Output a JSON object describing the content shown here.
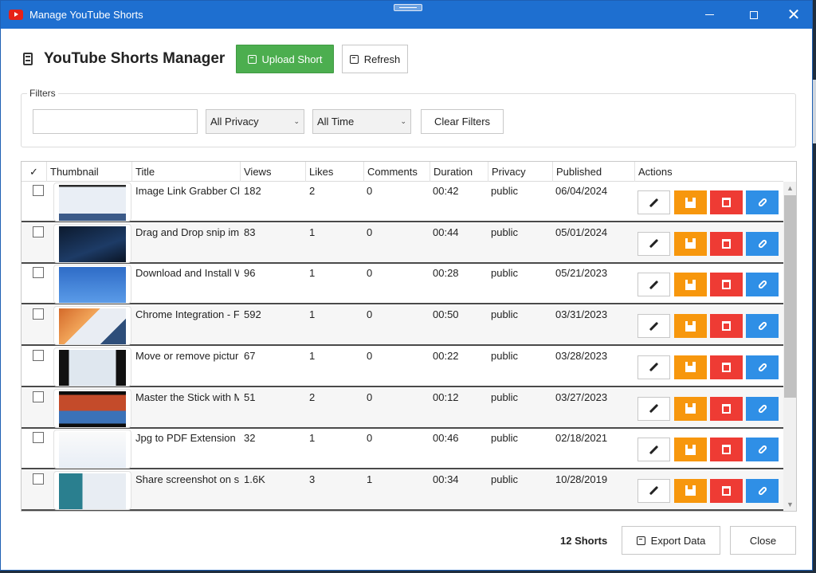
{
  "window": {
    "title": "Manage YouTube Shorts"
  },
  "header": {
    "title": "YouTube Shorts Manager",
    "upload_label": "Upload Short",
    "refresh_label": "Refresh"
  },
  "filters": {
    "legend": "Filters",
    "search_value": "",
    "privacy_selected": "All Privacy",
    "time_selected": "All Time",
    "clear_label": "Clear Filters"
  },
  "table": {
    "columns": [
      "✓",
      "Thumbnail",
      "Title",
      "Views",
      "Likes",
      "Comments",
      "Duration",
      "Privacy",
      "Published",
      "Actions"
    ],
    "rows": [
      {
        "title": "Image Link Grabber Chr",
        "views": "182",
        "likes": "2",
        "comments": "0",
        "duration": "00:42",
        "privacy": "public",
        "published": "06/04/2024"
      },
      {
        "title": "Drag and Drop snip ima",
        "views": "83",
        "likes": "1",
        "comments": "0",
        "duration": "00:44",
        "privacy": "public",
        "published": "05/01/2024"
      },
      {
        "title": "Download and Install W",
        "views": "96",
        "likes": "1",
        "comments": "0",
        "duration": "00:28",
        "privacy": "public",
        "published": "05/21/2023"
      },
      {
        "title": "Chrome Integration - Fr",
        "views": "592",
        "likes": "1",
        "comments": "0",
        "duration": "00:50",
        "privacy": "public",
        "published": "03/31/2023"
      },
      {
        "title": "Move or remove picture",
        "views": "67",
        "likes": "1",
        "comments": "0",
        "duration": "00:22",
        "privacy": "public",
        "published": "03/28/2023"
      },
      {
        "title": "Master the Stick with M",
        "views": "51",
        "likes": "2",
        "comments": "0",
        "duration": "00:12",
        "privacy": "public",
        "published": "03/27/2023"
      },
      {
        "title": "Jpg to PDF Extension",
        "views": "32",
        "likes": "1",
        "comments": "0",
        "duration": "00:46",
        "privacy": "public",
        "published": "02/18/2021"
      },
      {
        "title": "Share screenshot on sk",
        "views": "1.6K",
        "likes": "3",
        "comments": "1",
        "duration": "00:34",
        "privacy": "public",
        "published": "10/28/2019"
      }
    ]
  },
  "footer": {
    "count_label": "12 Shorts",
    "export_label": "Export Data",
    "close_label": "Close"
  },
  "colors": {
    "titlebar": "#1e6fd0",
    "upload": "#4cae4f",
    "save": "#f7970d",
    "delete": "#ee3b34",
    "link": "#2f8fe6"
  }
}
